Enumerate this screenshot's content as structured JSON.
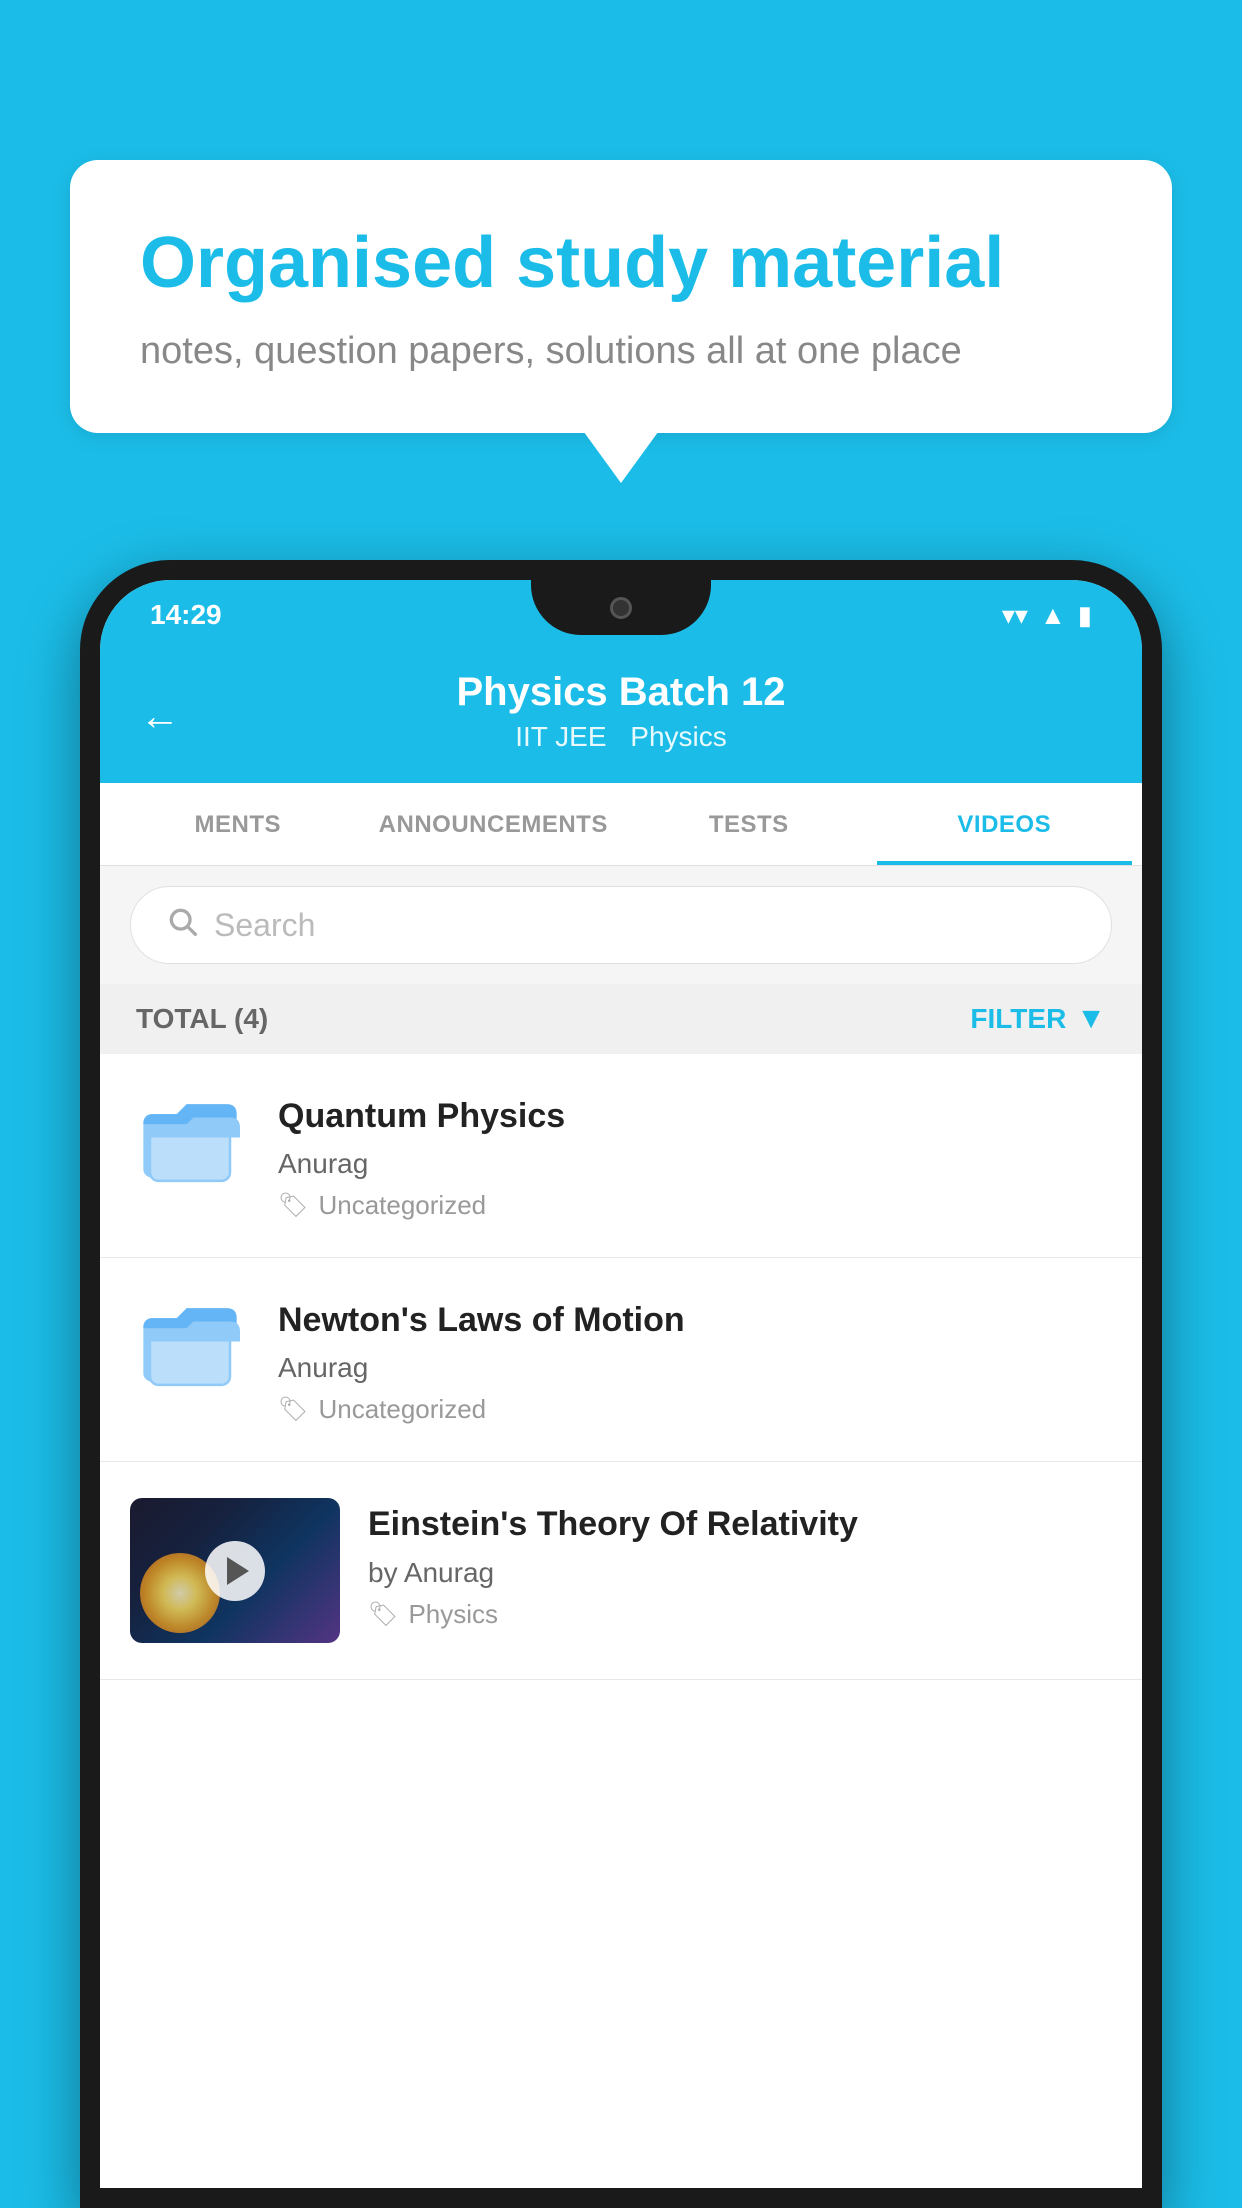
{
  "background": {
    "color": "#1BBDE8"
  },
  "speech_bubble": {
    "title": "Organised study material",
    "subtitle": "notes, question papers, solutions all at one place"
  },
  "phone": {
    "status_bar": {
      "time": "14:29",
      "wifi_icon": "wifi",
      "signal_icon": "signal",
      "battery_icon": "battery"
    },
    "top_bar": {
      "back_label": "←",
      "title": "Physics Batch 12",
      "tags": [
        "IIT JEE",
        "Physics"
      ]
    },
    "tabs": [
      {
        "label": "MENTS",
        "active": false
      },
      {
        "label": "ANNOUNCEMENTS",
        "active": false
      },
      {
        "label": "TESTS",
        "active": false
      },
      {
        "label": "VIDEOS",
        "active": true
      }
    ],
    "search": {
      "placeholder": "Search"
    },
    "filter_bar": {
      "total_label": "TOTAL (4)",
      "filter_label": "FILTER"
    },
    "videos": [
      {
        "id": 1,
        "title": "Quantum Physics",
        "author": "Anurag",
        "tag": "Uncategorized",
        "type": "folder"
      },
      {
        "id": 2,
        "title": "Newton's Laws of Motion",
        "author": "Anurag",
        "tag": "Uncategorized",
        "type": "folder"
      },
      {
        "id": 3,
        "title": "Einstein's Theory Of Relativity",
        "author_prefix": "by",
        "author": "Anurag",
        "tag": "Physics",
        "type": "video"
      }
    ]
  }
}
